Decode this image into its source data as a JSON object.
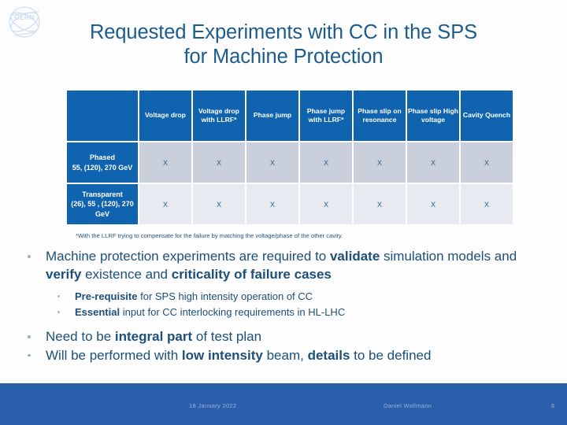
{
  "slide": {
    "title": "Requested Experiments with CC in the SPS\nfor Machine Protection",
    "title_color": "#1b5c8c",
    "header_blue": "#1063ae",
    "footer_blue": "#2b5eab",
    "row_shade_1": "#c9cfdb",
    "row_shade_2": "#e7eaf1"
  },
  "table": {
    "corner_label": "",
    "columns": [
      "Voltage drop",
      "Voltage drop with LLRF*",
      "Phase jump",
      "Phase jump with LLRF*",
      "Phase slip on resonance",
      "Phase slip High voltage",
      "Cavity Quench"
    ],
    "rows": [
      {
        "label": "Phased\n55, (120), 270 GeV",
        "cells": [
          "X",
          "X",
          "X",
          "X",
          "X",
          "X",
          "X"
        ]
      },
      {
        "label": "Transparent\n(26), 55 , (120), 270 GeV",
        "cells": [
          "X",
          "X",
          "X",
          "X",
          "X",
          "X",
          "X"
        ]
      }
    ],
    "footnote": "*With the LLRF trying to compensate for the failure by matching the voltage/phase of the other cavity."
  },
  "bullets": {
    "b1_p1": "Machine protection experiments are required to ",
    "b1_b1": "validate",
    "b1_p2": " simulation models and ",
    "b1_b2": "verify",
    "b1_p3": " existence and ",
    "b1_b3": "criticality of failure cases",
    "s1_b": "Pre-requisite",
    "s1_p": " for SPS high intensity operation of CC",
    "s2_b": "Essential",
    "s2_p": " input for CC interlocking requirements in HL-LHC",
    "b2_p1": "Need to be ",
    "b2_b1": "integral part",
    "b2_p2": " of test plan",
    "b3_p1": "Will be performed with ",
    "b3_b1": "low intensity",
    "b3_p2": " beam, ",
    "b3_b2": "details",
    "b3_p3": " to be defined"
  },
  "footer": {
    "logo_text": "CERN",
    "date": "18 January 2022",
    "author": "Daniel Wollmann",
    "page": "6"
  }
}
